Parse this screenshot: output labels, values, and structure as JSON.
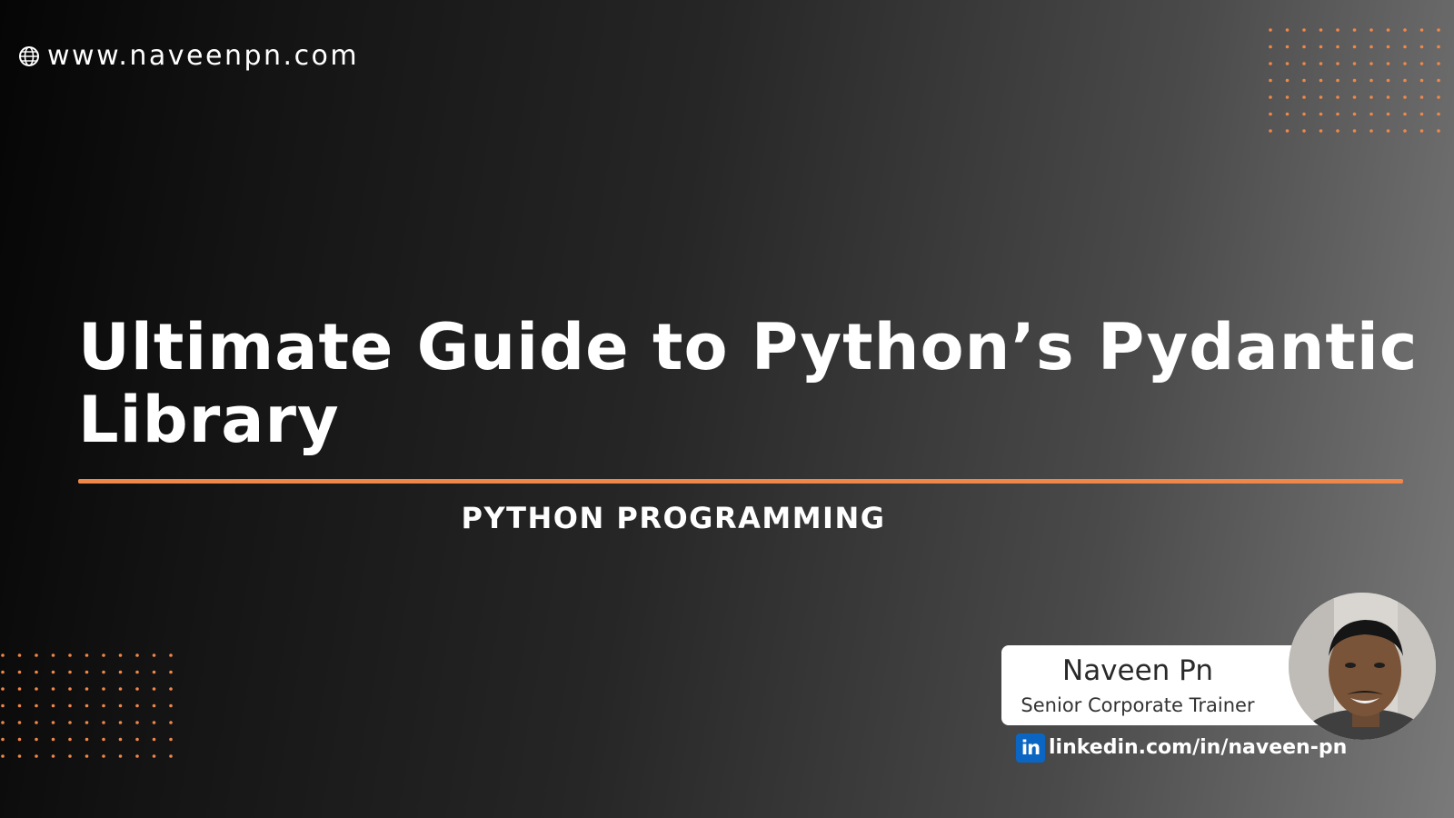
{
  "header": {
    "website": "www.naveenpn.com",
    "website_icon": "globe-icon"
  },
  "main": {
    "title": "Ultimate Guide to Python’s Pydantic Library",
    "category": "PYTHON PROGRAMMING"
  },
  "author": {
    "name": "Naveen Pn",
    "role": "Senior Corporate Trainer",
    "linkedin_icon": "linkedin-icon",
    "linkedin_icon_text": "in",
    "linkedin_url": "linkedin.com/in/naveen-pn",
    "avatar_icon": "avatar"
  },
  "colors": {
    "accent": "#f0874a",
    "linkedin": "#0a66c2",
    "card_background": "#ffffff",
    "background_dark": "#050505",
    "background_light": "#7a7a7a"
  }
}
